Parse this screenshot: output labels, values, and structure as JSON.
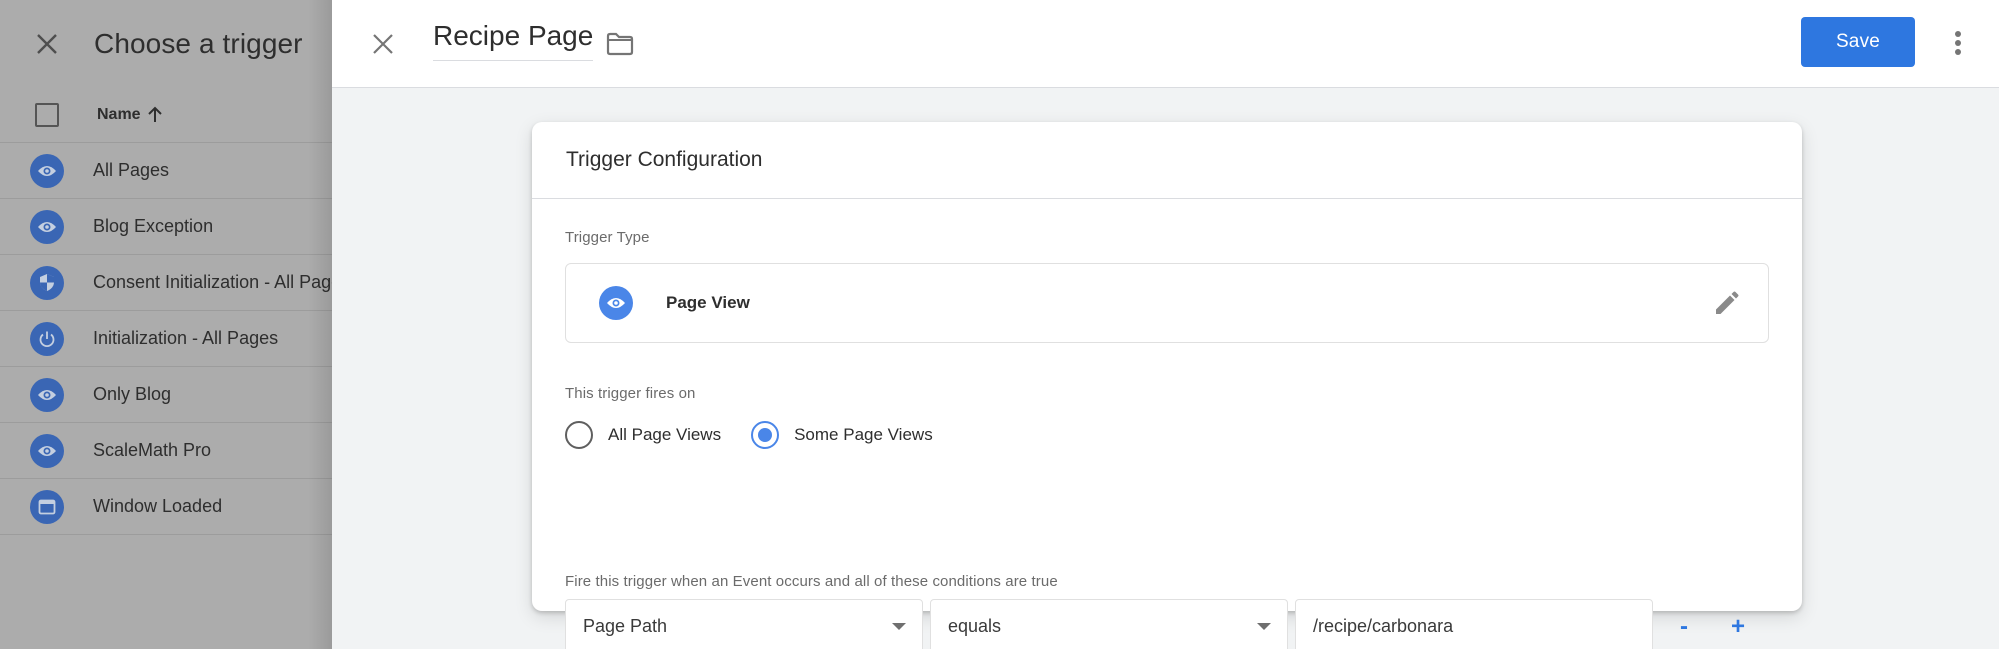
{
  "trigger_picker": {
    "title": "Choose a trigger",
    "column_header": "Name",
    "sort_direction_icon": "arrow-up-icon",
    "rows": [
      {
        "label": "All Pages",
        "icon": "eye-icon"
      },
      {
        "label": "Blog Exception",
        "icon": "eye-icon"
      },
      {
        "label": "Consent Initialization - All Pages",
        "icon": "shield-icon"
      },
      {
        "label": "Initialization - All Pages",
        "icon": "power-icon"
      },
      {
        "label": "Only Blog",
        "icon": "eye-icon"
      },
      {
        "label": "ScaleMath Pro",
        "icon": "eye-icon"
      },
      {
        "label": "Window Loaded",
        "icon": "window-icon"
      }
    ]
  },
  "header": {
    "trigger_name": "Recipe Page",
    "save_label": "Save"
  },
  "config": {
    "title": "Trigger Configuration",
    "trigger_type_label": "Trigger Type",
    "trigger_type_value": "Page View",
    "fires_on_label": "This trigger fires on",
    "fires_on_options": [
      {
        "label": "All Page Views",
        "checked": false
      },
      {
        "label": "Some Page Views",
        "checked": true
      }
    ],
    "conditions_label": "Fire this trigger when an Event occurs and all of these conditions are true",
    "condition": {
      "variable": "Page Path",
      "operator": "equals",
      "value": "/recipe/carbonara",
      "remove_label": "-",
      "add_label": "+"
    }
  },
  "colors": {
    "accent": "#2e77e0",
    "icon_blue": "#4a86e8",
    "overlay_icon_blue": "#3a66b4",
    "overlay_bg": "#acacac",
    "page_bg": "#f1f3f4"
  }
}
